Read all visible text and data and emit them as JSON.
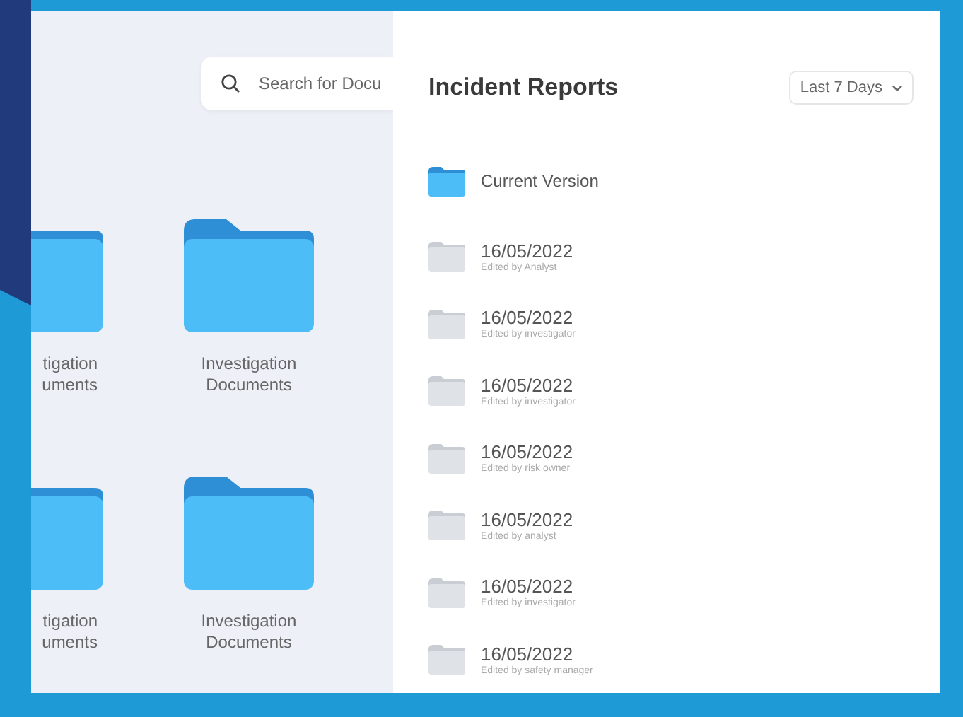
{
  "search": {
    "placeholder": "Search for Docu"
  },
  "folders": [
    {
      "kind": "partial",
      "lines": [
        "tigation",
        "uments"
      ]
    },
    {
      "kind": "full",
      "lines": [
        "Investigation",
        "Documents"
      ]
    },
    {
      "kind": "partial",
      "lines": [
        "tigation",
        "uments"
      ]
    },
    {
      "kind": "full",
      "lines": [
        "Investigation",
        "Documents"
      ]
    }
  ],
  "panel": {
    "title": "Incident Reports",
    "filter": "Last 7 Days"
  },
  "versions": [
    {
      "kind": "current",
      "label": "Current Version"
    },
    {
      "kind": "past",
      "date": "16/05/2022",
      "editor": "Edited by Analyst"
    },
    {
      "kind": "past",
      "date": "16/05/2022",
      "editor": "Edited by investigator"
    },
    {
      "kind": "past",
      "date": "16/05/2022",
      "editor": "Edited by investigator"
    },
    {
      "kind": "past",
      "date": "16/05/2022",
      "editor": "Edited by risk owner"
    },
    {
      "kind": "past",
      "date": "16/05/2022",
      "editor": "Edited by analyst"
    },
    {
      "kind": "past",
      "date": "16/05/2022",
      "editor": "Edited by investigator"
    },
    {
      "kind": "past",
      "date": "16/05/2022",
      "editor": "Edited by safety manager"
    }
  ]
}
